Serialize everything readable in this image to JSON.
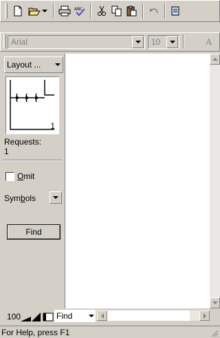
{
  "toolbar": {
    "icons": [
      "new-document-icon",
      "open-folder-icon",
      "dropdown-arrow-icon",
      "print-icon",
      "spell-check-icon",
      "cut-icon",
      "copy-icon",
      "paste-icon",
      "undo-icon",
      "overflow-icon"
    ]
  },
  "format_bar": {
    "font_name": "Arial",
    "font_size": "10",
    "font_color_label": "A"
  },
  "left_panel": {
    "layout_label": "Layout ...",
    "preview_number": "1",
    "requests_label": "Requests:",
    "requests_value": "1",
    "omit_label_first": "O",
    "omit_label_rest": "mit",
    "omit_checked": false,
    "symbols_label_a": "Sym",
    "symbols_label_b": "b",
    "symbols_label_c": "ols",
    "find_button_label": "Find"
  },
  "bottom_bar": {
    "zoom_value": "100",
    "find_selected": "Find"
  },
  "status_bar": {
    "help_text": "For Help, press F1"
  },
  "colors": {
    "face": "#d4d0c8",
    "shadow": "#808080",
    "highlight": "#ffffff",
    "workspace": "#ffffff"
  }
}
